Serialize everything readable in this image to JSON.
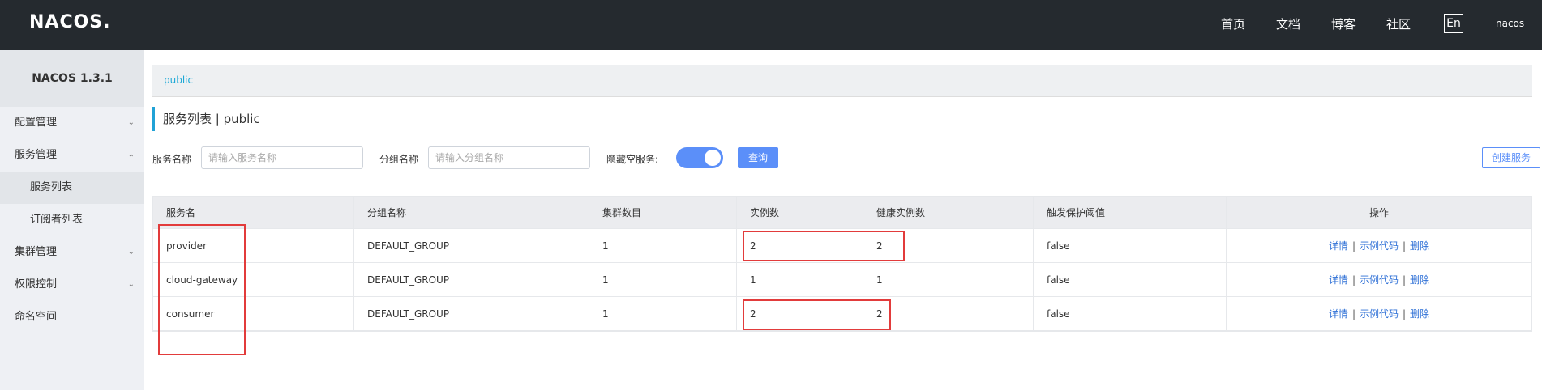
{
  "header": {
    "logo": "NACOS.",
    "nav": [
      "首页",
      "文档",
      "博客",
      "社区"
    ],
    "lang": "En",
    "user": "nacos"
  },
  "sidebar": {
    "version": "NACOS 1.3.1",
    "items": [
      {
        "label": "配置管理",
        "chevron": "chevron-down-icon"
      },
      {
        "label": "服务管理",
        "chevron": "chevron-up-icon"
      },
      {
        "label": "服务列表",
        "sub": true,
        "active": true
      },
      {
        "label": "订阅者列表",
        "sub": true
      },
      {
        "label": "集群管理",
        "chevron": "chevron-down-icon"
      },
      {
        "label": "权限控制",
        "chevron": "chevron-down-icon"
      },
      {
        "label": "命名空间"
      }
    ]
  },
  "breadcrumb": "public",
  "page_title": "服务列表 | public",
  "filters": {
    "service_label": "服务名称",
    "service_placeholder": "请输入服务名称",
    "group_label": "分组名称",
    "group_placeholder": "请输入分组名称",
    "hide_empty_label": "隐藏空服务:",
    "hide_empty_on": true,
    "query_button": "查询",
    "create_button": "创建服务"
  },
  "table": {
    "columns": [
      "服务名",
      "分组名称",
      "集群数目",
      "实例数",
      "健康实例数",
      "触发保护阈值",
      "操作"
    ],
    "rows": [
      [
        "provider",
        "DEFAULT_GROUP",
        "1",
        "2",
        "2",
        "false"
      ],
      [
        "cloud-gateway",
        "DEFAULT_GROUP",
        "1",
        "1",
        "1",
        "false"
      ],
      [
        "consumer",
        "DEFAULT_GROUP",
        "1",
        "2",
        "2",
        "false"
      ]
    ],
    "actions": [
      "详情",
      "示例代码",
      "删除"
    ],
    "action_separator": "|"
  },
  "colors": {
    "topbar": "#252a2f",
    "accent": "#5b8ff9",
    "highlight": "#e23b3b"
  }
}
